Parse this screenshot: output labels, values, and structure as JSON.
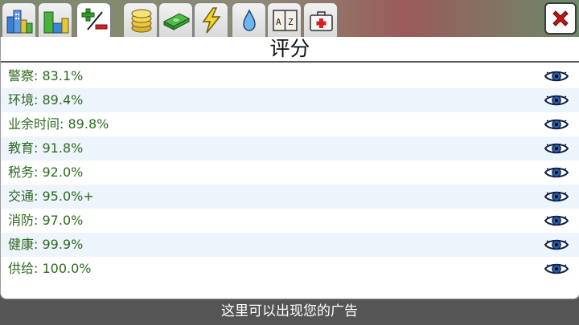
{
  "toolbar": {
    "tabs": [
      {
        "icon": "city-skyline-icon",
        "active": false
      },
      {
        "icon": "zoning-blocks-icon",
        "active": false
      },
      {
        "icon": "plus-minus-icon",
        "active": true
      },
      {
        "icon": "coins-icon",
        "active": false
      },
      {
        "icon": "banknotes-icon",
        "active": false
      },
      {
        "icon": "lightning-icon",
        "active": false
      },
      {
        "icon": "water-drop-icon",
        "active": false
      },
      {
        "icon": "dictionary-book-icon",
        "active": false
      },
      {
        "icon": "first-aid-kit-icon",
        "active": false
      }
    ],
    "close_icon": "close-icon"
  },
  "panel": {
    "title": "评分",
    "ratings": [
      {
        "name": "警察",
        "value": "83.1%"
      },
      {
        "name": "环境",
        "value": "89.4%"
      },
      {
        "name": "业余时间",
        "value": "89.8%"
      },
      {
        "name": "教育",
        "value": "91.8%"
      },
      {
        "name": "税务",
        "value": "92.0%"
      },
      {
        "name": "交通",
        "value": "95.0%+"
      },
      {
        "name": "消防",
        "value": "97.0%"
      },
      {
        "name": "健康",
        "value": "99.9%"
      },
      {
        "name": "供给",
        "value": "100.0%"
      }
    ],
    "separator": ": ",
    "row_action_icon": "eye-icon"
  },
  "ad_bar": {
    "text": "这里可以出现您的广告"
  },
  "colors": {
    "rating_text": "#2d6a1f",
    "row_stripe": "#eef4fb",
    "ad_bar_bg": "#555555",
    "close_x": "#c41414"
  }
}
